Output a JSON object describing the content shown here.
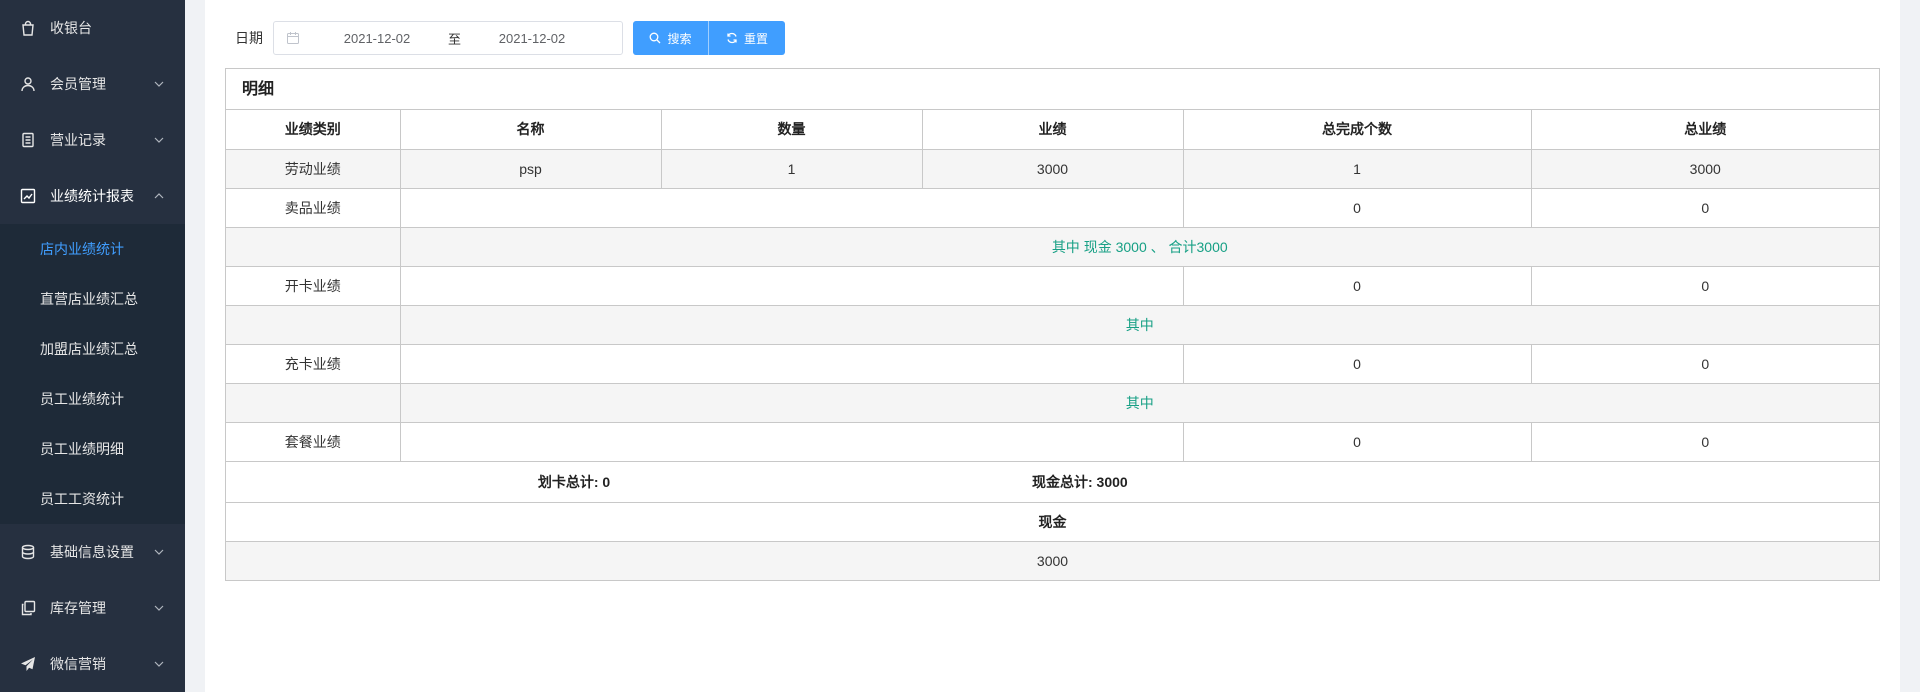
{
  "sidebar": {
    "items": [
      {
        "label": "收银台",
        "icon": "shopping-bag-icon",
        "has_chevron": false
      },
      {
        "label": "会员管理",
        "icon": "user-icon",
        "has_chevron": true
      },
      {
        "label": "营业记录",
        "icon": "document-icon",
        "has_chevron": true
      },
      {
        "label": "业绩统计报表",
        "icon": "chart-icon",
        "has_chevron": true,
        "open": true
      },
      {
        "label": "基础信息设置",
        "icon": "database-icon",
        "has_chevron": true
      },
      {
        "label": "库存管理",
        "icon": "copy-icon",
        "has_chevron": true
      },
      {
        "label": "微信营销",
        "icon": "paper-plane-icon",
        "has_chevron": true
      }
    ],
    "submenu": [
      {
        "label": "店内业绩统计",
        "active": true
      },
      {
        "label": "直营店业绩汇总"
      },
      {
        "label": "加盟店业绩汇总"
      },
      {
        "label": "员工业绩统计"
      },
      {
        "label": "员工业绩明细"
      },
      {
        "label": "员工工资统计"
      }
    ]
  },
  "toolbar": {
    "date_label": "日期",
    "start_date": "2021-12-02",
    "separator": "至",
    "end_date": "2021-12-02",
    "search_label": "搜索",
    "reset_label": "重置"
  },
  "detail": {
    "title": "明细",
    "headers": [
      "业绩类别",
      "名称",
      "数量",
      "业绩",
      "总完成个数",
      "总业绩"
    ],
    "labor": {
      "category": "劳动业绩",
      "name": "psp",
      "qty": "1",
      "perf": "3000",
      "total_count": "1",
      "total_perf": "3000"
    },
    "sales": {
      "category": "卖品业绩",
      "total_count": "0",
      "total_perf": "0",
      "note": "其中 现金 3000 、 合计3000"
    },
    "card_open": {
      "category": "开卡业绩",
      "total_count": "0",
      "total_perf": "0",
      "note": "其中"
    },
    "recharge": {
      "category": "充卡业绩",
      "total_count": "0",
      "total_perf": "0",
      "note": "其中"
    },
    "package": {
      "category": "套餐业绩",
      "total_count": "0",
      "total_perf": "0"
    },
    "card_deduct_total": "划卡总计: 0",
    "cash_total": "现金总计: 3000",
    "pay_method_header": "现金",
    "pay_method_value": "3000"
  },
  "colors": {
    "accent": "#409eff",
    "sidebar_bg": "#263040",
    "note_green": "#17a085"
  }
}
